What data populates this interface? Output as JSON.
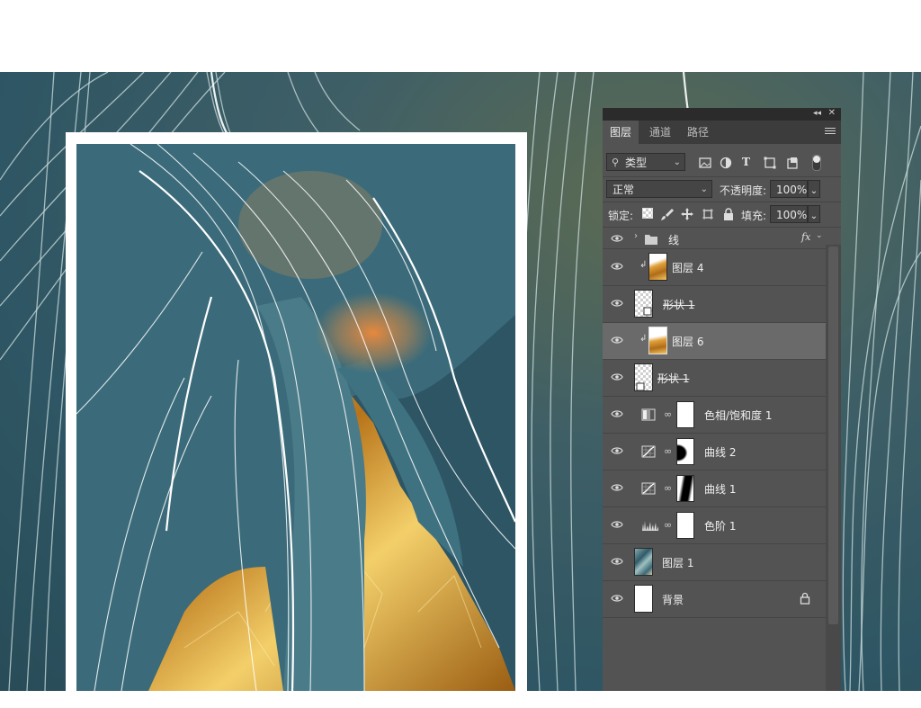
{
  "canvas": {
    "background_art": "teal-line-art",
    "artwork": "teal-leaf-and-gold-foil"
  },
  "panel": {
    "tabs": [
      {
        "label": "图层",
        "active": true
      },
      {
        "label": "通道",
        "active": false
      },
      {
        "label": "路径",
        "active": false
      }
    ],
    "filter": {
      "value": "类型"
    },
    "blend_mode": {
      "value": "正常"
    },
    "opacity": {
      "label": "不透明度:",
      "value": "100%"
    },
    "lock": {
      "label": "锁定:"
    },
    "fill": {
      "label": "填充:",
      "value": "100%"
    },
    "layers": [
      {
        "name": "线",
        "kind": "group",
        "fx": "fx",
        "visible": true
      },
      {
        "name": "图层 4",
        "kind": "pixel-gold",
        "clipped": true,
        "visible": true
      },
      {
        "name": "形状 1",
        "kind": "shape",
        "strikethrough": true,
        "visible": true
      },
      {
        "name": "图层 6",
        "kind": "pixel-gold",
        "clipped": true,
        "selected": true,
        "visible": true
      },
      {
        "name": "形状 1",
        "kind": "shape",
        "strikethrough": true,
        "visible": true
      },
      {
        "name": "色相/饱和度 1",
        "kind": "hue-saturation",
        "mask": "white",
        "visible": true
      },
      {
        "name": "曲线 2",
        "kind": "curves",
        "mask": "black-shape",
        "visible": true
      },
      {
        "name": "曲线 1",
        "kind": "curves",
        "mask": "black-shape",
        "visible": true
      },
      {
        "name": "色阶 1",
        "kind": "levels",
        "mask": "white",
        "visible": true
      },
      {
        "name": "图层 1",
        "kind": "pixel-photo",
        "visible": true
      },
      {
        "name": "背景",
        "kind": "background",
        "locked": true,
        "visible": true
      }
    ]
  },
  "colors": {
    "panel_bg": "#535353",
    "tab_bar": "#3c3c3c",
    "selected_layer": "#6a6a6a",
    "teal_art": "#2f5a69",
    "gold_foil": "#d9a021"
  }
}
